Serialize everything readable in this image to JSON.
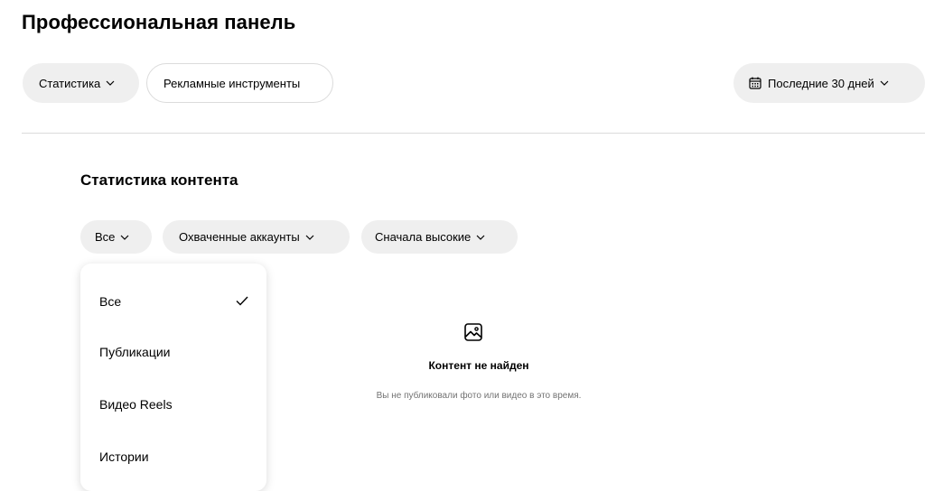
{
  "header": {
    "title": "Профессиональная панель"
  },
  "toolbar": {
    "stats_label": "Статистика",
    "ad_tools_label": "Рекламные инструменты",
    "date_range_label": "Последние 30 дней"
  },
  "content": {
    "section_title": "Статистика контента",
    "filters": {
      "type_label": "Все",
      "metric_label": "Охваченные аккаунты",
      "sort_label": "Сначала высокие"
    },
    "type_dropdown": {
      "items": [
        {
          "label": "Все",
          "selected": true
        },
        {
          "label": "Публикации",
          "selected": false
        },
        {
          "label": "Видео Reels",
          "selected": false
        },
        {
          "label": "Истории",
          "selected": false
        }
      ]
    },
    "empty_state": {
      "icon": "image-icon",
      "title": "Контент не найден",
      "subtitle": "Вы не публиковали фото или видео в это время."
    }
  },
  "colors": {
    "pill_bg": "#efefef",
    "border": "#dbdbdb",
    "muted_text": "#737373"
  }
}
